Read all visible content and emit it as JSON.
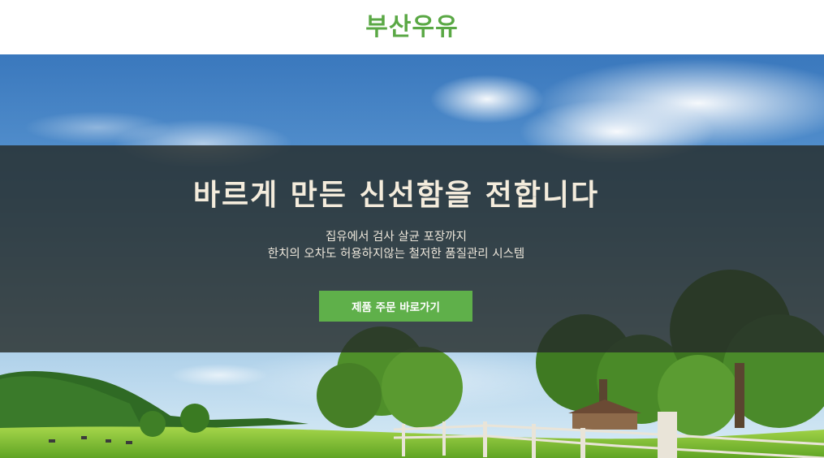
{
  "colors": {
    "brand": "#5aa845",
    "cta": "#5fb04a",
    "sky_top": "#3f7fc0",
    "grass": "#7fc43a"
  },
  "header": {
    "logo_text": "부산우유"
  },
  "hero": {
    "headline": "바르게 만든 신선함을 전합니다",
    "subtitle_line1": "집유에서 검사 살균 포장까지",
    "subtitle_line2": "한치의 오차도 허용하지않는 철저한 품질관리 시스템",
    "cta_label": "제품 주문 바로가기"
  }
}
